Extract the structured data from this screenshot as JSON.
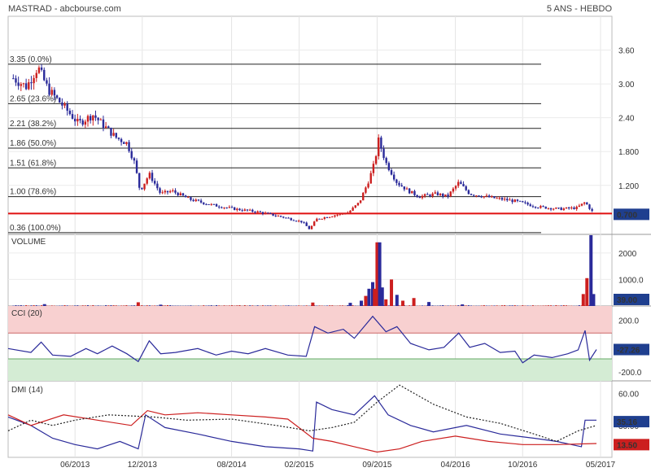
{
  "header": {
    "title": "MASTRAD - abcbourse.com",
    "period": "5 ANS - HEBDO"
  },
  "colors": {
    "up": "#cc1f1f",
    "down": "#2a2a9a",
    "support": "#e01010",
    "cci_overbought": "#f8d0d0",
    "cci_oversold": "#d4ecd4",
    "dmi_plus": "#2a2a9a",
    "dmi_minus": "#cc1f1f",
    "adx": "#222222",
    "value_badge": "#1f3f8f",
    "minus_badge": "#cc1f1f"
  },
  "chart_data": [
    {
      "type": "candlestick",
      "name": "price",
      "x_dates": [
        "06/2013",
        "12/2013",
        "08/2014",
        "02/2015",
        "09/2015",
        "04/2016",
        "10/2016",
        "05/2017"
      ],
      "xlim": [
        "2012-12-01",
        "2017-06-01"
      ],
      "ylim": [
        0.33,
        4.2
      ],
      "y_ticks": [
        "3.60",
        "3.00",
        "2.40",
        "1.800",
        "1.200"
      ],
      "y_tick_values": [
        3.6,
        3.0,
        2.4,
        1.8,
        1.2
      ],
      "fib_levels": [
        {
          "label": "3.35 (0.0%)",
          "value": 3.35
        },
        {
          "label": "2.65 (23.6%)",
          "value": 2.65
        },
        {
          "label": "2.21 (38.2%)",
          "value": 2.21
        },
        {
          "label": "1.86 (50.0%)",
          "value": 1.86
        },
        {
          "label": "1.51 (61.8%)",
          "value": 1.51
        },
        {
          "label": "1.00 (78.6%)",
          "value": 1.0
        },
        {
          "label": "0.36 (100.0%)",
          "value": 0.36
        }
      ],
      "support_level": 0.7,
      "last_value": "0.700",
      "key_points": [
        [
          "2012-12-15",
          3.1
        ],
        [
          "2013-01-20",
          2.95
        ],
        [
          "2013-02-20",
          3.3
        ],
        [
          "2013-03-20",
          2.9
        ],
        [
          "2013-05-01",
          2.6
        ],
        [
          "2013-06-10",
          2.3
        ],
        [
          "2013-07-20",
          2.45
        ],
        [
          "2013-08-20",
          2.25
        ],
        [
          "2013-09-20",
          2.05
        ],
        [
          "2013-10-20",
          1.95
        ],
        [
          "2013-11-10",
          1.6
        ],
        [
          "2013-11-25",
          1.1
        ],
        [
          "2013-12-20",
          1.4
        ],
        [
          "2014-01-20",
          1.05
        ],
        [
          "2014-02-20",
          1.1
        ],
        [
          "2014-04-10",
          0.95
        ],
        [
          "2014-06-10",
          0.85
        ],
        [
          "2014-08-10",
          0.78
        ],
        [
          "2014-10-10",
          0.73
        ],
        [
          "2014-12-10",
          0.65
        ],
        [
          "2015-02-10",
          0.55
        ],
        [
          "2015-03-01",
          0.42
        ],
        [
          "2015-03-20",
          0.6
        ],
        [
          "2015-05-01",
          0.66
        ],
        [
          "2015-06-15",
          0.72
        ],
        [
          "2015-07-15",
          0.9
        ],
        [
          "2015-08-10",
          1.3
        ],
        [
          "2015-08-25",
          1.6
        ],
        [
          "2015-09-05",
          2.0
        ],
        [
          "2015-09-25",
          1.6
        ],
        [
          "2015-10-25",
          1.25
        ],
        [
          "2015-11-25",
          1.1
        ],
        [
          "2015-12-25",
          1.0
        ],
        [
          "2016-02-10",
          1.05
        ],
        [
          "2016-03-10",
          1.0
        ],
        [
          "2016-04-10",
          1.25
        ],
        [
          "2016-05-10",
          1.05
        ],
        [
          "2016-07-10",
          0.98
        ],
        [
          "2016-09-10",
          0.92
        ],
        [
          "2016-11-10",
          0.82
        ],
        [
          "2017-01-10",
          0.78
        ],
        [
          "2017-02-25",
          0.8
        ],
        [
          "2017-03-20",
          0.9
        ],
        [
          "2017-04-10",
          0.72
        ]
      ]
    },
    {
      "type": "bar",
      "name": "VOLUME",
      "title": "VOLUME",
      "ylim": [
        0,
        2700
      ],
      "y_ticks": [
        "2000",
        "1000.0"
      ],
      "y_tick_values": [
        2000,
        1000
      ],
      "last_value": "39.00",
      "spikes": [
        [
          "2013-03-10",
          70,
          "d"
        ],
        [
          "2013-11-20",
          140,
          "u"
        ],
        [
          "2014-01-20",
          50,
          "d"
        ],
        [
          "2015-03-10",
          130,
          "u"
        ],
        [
          "2015-06-20",
          120,
          "d"
        ],
        [
          "2015-07-20",
          200,
          "d"
        ],
        [
          "2015-08-01",
          380,
          "u"
        ],
        [
          "2015-08-10",
          650,
          "d"
        ],
        [
          "2015-08-20",
          900,
          "d"
        ],
        [
          "2015-08-25",
          650,
          "u"
        ],
        [
          "2015-09-01",
          2400,
          "u"
        ],
        [
          "2015-09-08",
          2400,
          "d"
        ],
        [
          "2015-09-15",
          700,
          "d"
        ],
        [
          "2015-09-25",
          250,
          "u"
        ],
        [
          "2015-10-10",
          1000,
          "u"
        ],
        [
          "2015-10-25",
          420,
          "d"
        ],
        [
          "2015-11-10",
          200,
          "u"
        ],
        [
          "2015-12-10",
          300,
          "u"
        ],
        [
          "2016-01-20",
          150,
          "d"
        ],
        [
          "2016-04-20",
          60,
          "d"
        ],
        [
          "2017-03-15",
          450,
          "u"
        ],
        [
          "2017-03-25",
          1050,
          "u"
        ],
        [
          "2017-04-05",
          2750,
          "d"
        ],
        [
          "2017-04-12",
          450,
          "d"
        ]
      ]
    },
    {
      "type": "line",
      "name": "CCI",
      "title": "CCI (20)",
      "ylim": [
        -270,
        310
      ],
      "y_ticks": [
        "200.0",
        "-200.0"
      ],
      "y_tick_values": [
        200,
        -200
      ],
      "bands": {
        "overbought": 100,
        "oversold": -100
      },
      "last_value": "-27.26",
      "key_points": [
        [
          "2012-12-01",
          -20
        ],
        [
          "2013-02-01",
          -50
        ],
        [
          "2013-03-01",
          30
        ],
        [
          "2013-04-01",
          -70
        ],
        [
          "2013-05-20",
          -80
        ],
        [
          "2013-07-01",
          -20
        ],
        [
          "2013-08-01",
          -60
        ],
        [
          "2013-09-10",
          0
        ],
        [
          "2013-10-20",
          -60
        ],
        [
          "2013-11-20",
          -120
        ],
        [
          "2013-12-20",
          40
        ],
        [
          "2014-01-20",
          -60
        ],
        [
          "2014-03-01",
          -50
        ],
        [
          "2014-05-01",
          -20
        ],
        [
          "2014-06-20",
          -70
        ],
        [
          "2014-08-01",
          -40
        ],
        [
          "2014-09-15",
          -60
        ],
        [
          "2014-11-01",
          -20
        ],
        [
          "2015-01-01",
          -70
        ],
        [
          "2015-02-20",
          -80
        ],
        [
          "2015-03-15",
          150
        ],
        [
          "2015-04-20",
          100
        ],
        [
          "2015-06-01",
          130
        ],
        [
          "2015-07-01",
          60
        ],
        [
          "2015-08-20",
          230
        ],
        [
          "2015-09-25",
          110
        ],
        [
          "2015-10-25",
          150
        ],
        [
          "2015-12-01",
          20
        ],
        [
          "2016-01-20",
          -30
        ],
        [
          "2016-03-01",
          -10
        ],
        [
          "2016-04-10",
          100
        ],
        [
          "2016-05-10",
          -10
        ],
        [
          "2016-06-20",
          20
        ],
        [
          "2016-08-01",
          -50
        ],
        [
          "2016-09-10",
          -40
        ],
        [
          "2016-10-01",
          -130
        ],
        [
          "2016-11-01",
          -70
        ],
        [
          "2016-12-20",
          -90
        ],
        [
          "2017-02-01",
          -60
        ],
        [
          "2017-03-01",
          -30
        ],
        [
          "2017-03-20",
          120
        ],
        [
          "2017-04-01",
          -110
        ],
        [
          "2017-04-20",
          -27
        ]
      ]
    },
    {
      "type": "line",
      "name": "DMI",
      "title": "DMI (14)",
      "ylim": [
        0,
        72
      ],
      "y_ticks": [
        "60.00",
        "30.00"
      ],
      "y_tick_values": [
        60,
        30
      ],
      "last_values": [
        "35.16",
        "13.50"
      ],
      "series": [
        {
          "key": "plus",
          "points": [
            [
              "2012-12-01",
              38
            ],
            [
              "2013-02-01",
              30
            ],
            [
              "2013-04-01",
              18
            ],
            [
              "2013-06-01",
              12
            ],
            [
              "2013-08-01",
              8
            ],
            [
              "2013-10-01",
              15
            ],
            [
              "2013-11-20",
              8
            ],
            [
              "2013-12-10",
              40
            ],
            [
              "2014-02-01",
              28
            ],
            [
              "2014-05-01",
              22
            ],
            [
              "2014-08-01",
              15
            ],
            [
              "2014-11-01",
              10
            ],
            [
              "2015-02-01",
              8
            ],
            [
              "2015-03-10",
              6
            ],
            [
              "2015-03-20",
              52
            ],
            [
              "2015-05-01",
              45
            ],
            [
              "2015-07-01",
              40
            ],
            [
              "2015-08-25",
              58
            ],
            [
              "2015-10-01",
              40
            ],
            [
              "2015-12-01",
              30
            ],
            [
              "2016-02-01",
              24
            ],
            [
              "2016-05-01",
              30
            ],
            [
              "2016-08-01",
              22
            ],
            [
              "2016-11-01",
              18
            ],
            [
              "2017-01-01",
              15
            ],
            [
              "2017-03-10",
              10
            ],
            [
              "2017-03-20",
              35
            ],
            [
              "2017-04-20",
              35
            ]
          ]
        },
        {
          "key": "minus",
          "points": [
            [
              "2012-12-01",
              40
            ],
            [
              "2013-02-01",
              30
            ],
            [
              "2013-05-01",
              40
            ],
            [
              "2013-08-01",
              35
            ],
            [
              "2013-11-01",
              30
            ],
            [
              "2013-12-15",
              44
            ],
            [
              "2014-02-01",
              40
            ],
            [
              "2014-05-01",
              42
            ],
            [
              "2014-08-01",
              40
            ],
            [
              "2014-11-01",
              38
            ],
            [
              "2015-01-01",
              36
            ],
            [
              "2015-03-10",
              18
            ],
            [
              "2015-05-01",
              15
            ],
            [
              "2015-07-01",
              10
            ],
            [
              "2015-09-01",
              5
            ],
            [
              "2015-11-01",
              8
            ],
            [
              "2016-01-01",
              15
            ],
            [
              "2016-04-01",
              20
            ],
            [
              "2016-07-01",
              15
            ],
            [
              "2016-10-01",
              12
            ],
            [
              "2017-01-01",
              12
            ],
            [
              "2017-04-20",
              13
            ]
          ]
        },
        {
          "key": "adx",
          "points": [
            [
              "2012-12-01",
              25
            ],
            [
              "2013-02-01",
              35
            ],
            [
              "2013-04-01",
              30
            ],
            [
              "2013-06-01",
              35
            ],
            [
              "2013-09-01",
              40
            ],
            [
              "2014-01-01",
              38
            ],
            [
              "2014-04-01",
              35
            ],
            [
              "2014-08-01",
              36
            ],
            [
              "2014-12-01",
              30
            ],
            [
              "2015-03-01",
              25
            ],
            [
              "2015-05-01",
              28
            ],
            [
              "2015-07-01",
              33
            ],
            [
              "2015-09-01",
              52
            ],
            [
              "2015-11-01",
              68
            ],
            [
              "2016-02-01",
              50
            ],
            [
              "2016-05-01",
              38
            ],
            [
              "2016-08-01",
              32
            ],
            [
              "2016-11-01",
              22
            ],
            [
              "2017-01-01",
              15
            ],
            [
              "2017-03-01",
              25
            ],
            [
              "2017-04-20",
              30
            ]
          ]
        }
      ]
    }
  ]
}
